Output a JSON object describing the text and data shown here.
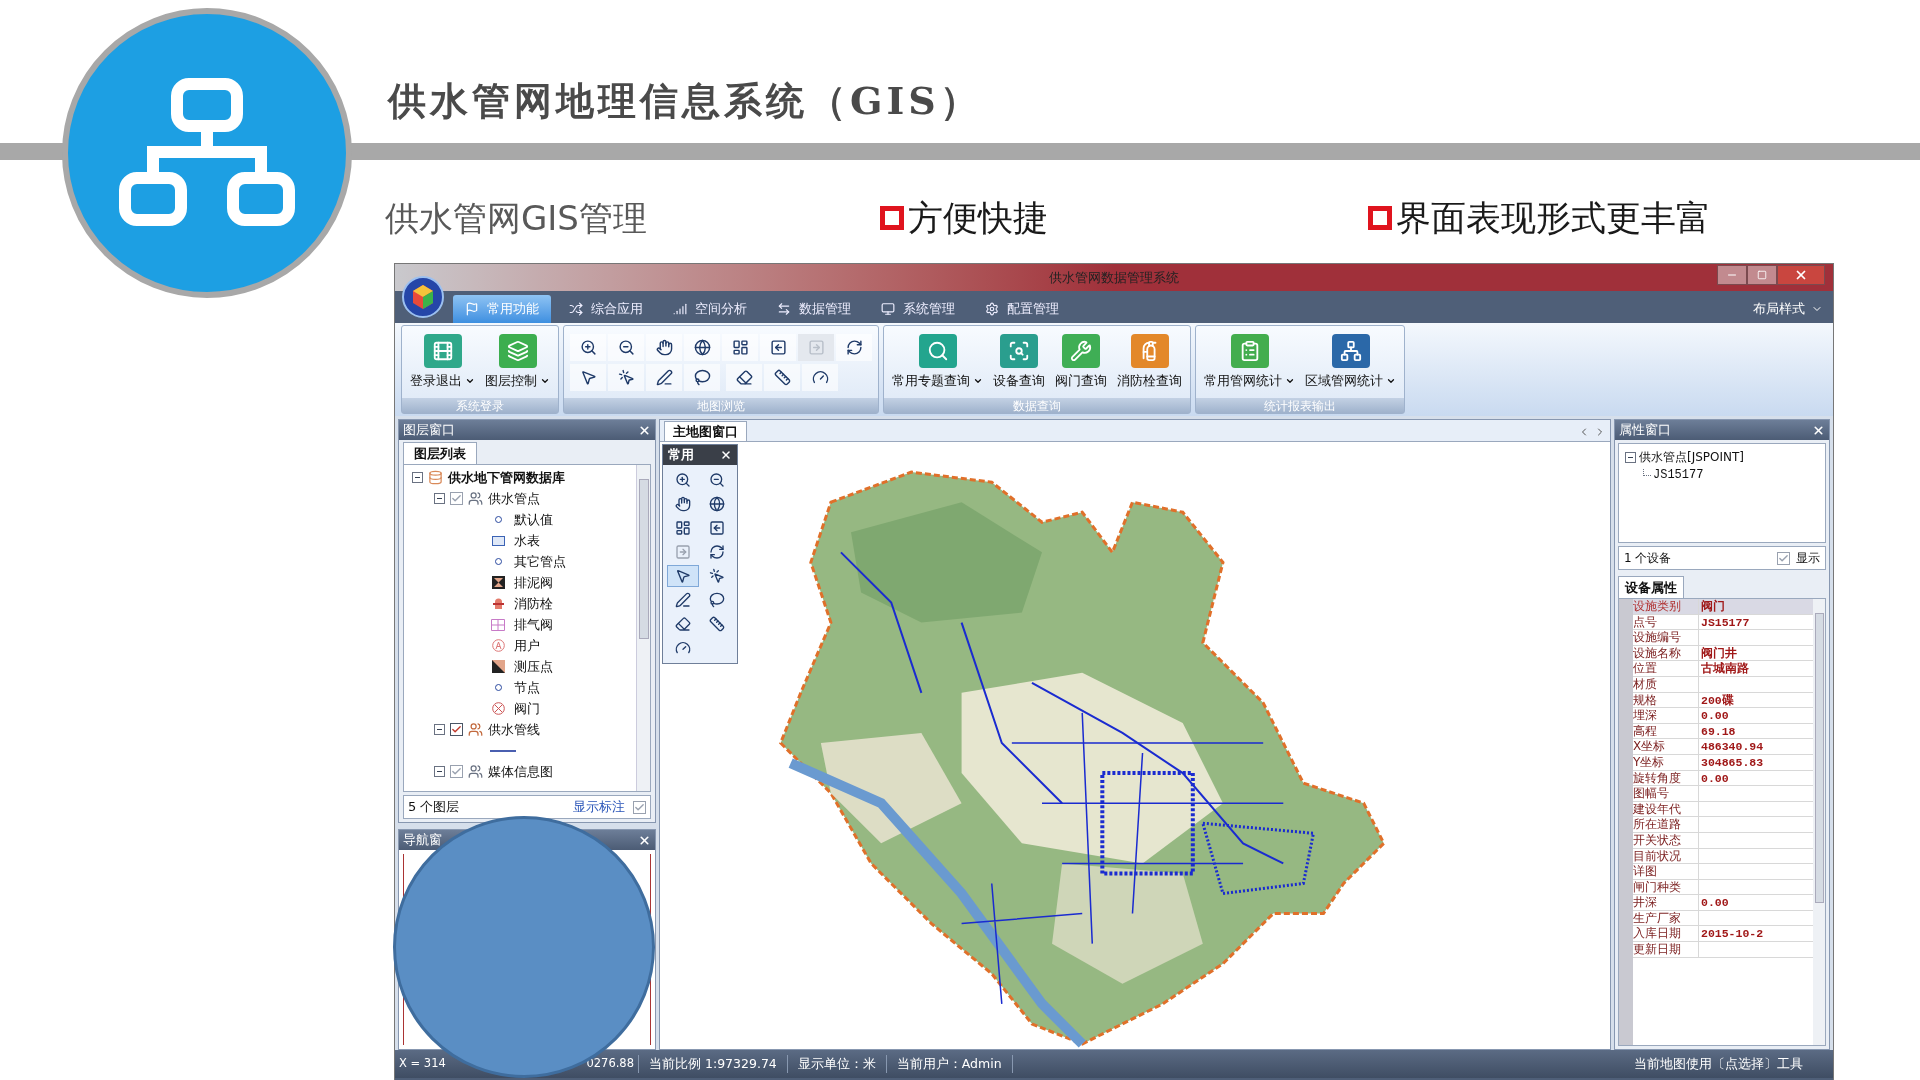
{
  "slide": {
    "title": "供水管网地理信息系统（GIS）",
    "subtitle": "供水管网GIS管理",
    "bullets": [
      "方便快捷",
      "界面表现形式更丰富"
    ]
  },
  "window": {
    "title": "供水管网数据管理系统"
  },
  "menu_tabs": [
    {
      "label": "常用功能",
      "selected": true
    },
    {
      "label": "综合应用",
      "selected": false
    },
    {
      "label": "空间分析",
      "selected": false
    },
    {
      "label": "数据管理",
      "selected": false
    },
    {
      "label": "系统管理",
      "selected": false
    },
    {
      "label": "配置管理",
      "selected": false
    }
  ],
  "layout_menu": "布局样式",
  "ribbon_groups": [
    {
      "kind": "large",
      "label": "系统登录",
      "items": [
        {
          "label": "登录退出",
          "dropdown": true
        },
        {
          "label": "图层控制",
          "dropdown": true
        }
      ]
    },
    {
      "kind": "tools",
      "label": "地图浏览",
      "rows": [
        [
          {
            "disabled": false
          },
          {
            "disabled": false
          },
          {
            "disabled": false
          },
          {
            "disabled": false
          },
          {
            "disabled": false
          },
          {
            "disabled": false
          },
          {
            "disabled": true
          },
          {
            "disabled": false
          }
        ],
        [
          {
            "disabled": false
          },
          {
            "disabled": false
          },
          {
            "disabled": false
          },
          {
            "disabled": false
          },
          {
            "disabled": false
          },
          {
            "disabled": false
          },
          {
            "disabled": false
          }
        ]
      ]
    },
    {
      "kind": "large",
      "label": "数据查询",
      "items": [
        {
          "label": "常用专题查询",
          "dropdown": true
        },
        {
          "label": "设备查询",
          "dropdown": false
        },
        {
          "label": "阀门查询",
          "dropdown": false
        },
        {
          "label": "消防栓查询",
          "dropdown": false
        }
      ]
    },
    {
      "kind": "large",
      "label": "统计报表输出",
      "items": [
        {
          "label": "常用管网统计",
          "dropdown": true
        },
        {
          "label": "区域管网统计",
          "dropdown": true
        }
      ]
    }
  ],
  "layer_window": {
    "title": "图层窗口",
    "tab": "图层列表",
    "tree": [
      {
        "kind": "database",
        "label": "供水地下管网数据库",
        "expanded": true,
        "children": [
          {
            "kind": "layer",
            "label": "供水管点",
            "expanded": true,
            "checked": true,
            "dimmed": true,
            "children": [
              {
                "kind": "dot",
                "label": "默认值"
              },
              {
                "kind": "meter",
                "label": "水表"
              },
              {
                "kind": "dot",
                "label": "其它管点"
              },
              {
                "kind": "hourglass",
                "label": "排泥阀"
              },
              {
                "kind": "hydrant",
                "label": "消防栓"
              },
              {
                "kind": "grid",
                "label": "排气阀"
              },
              {
                "kind": "user",
                "label": "用户"
              },
              {
                "kind": "triangle",
                "label": "测压点"
              },
              {
                "kind": "dot",
                "label": "节点"
              },
              {
                "kind": "cross",
                "label": "阀门"
              }
            ]
          },
          {
            "kind": "layer",
            "label": "供水管线",
            "expanded": true,
            "checked": true,
            "dimmed": false,
            "children": [
              {
                "kind": "line"
              }
            ]
          },
          {
            "kind": "layer",
            "label": "媒体信息图",
            "expanded": true,
            "checked": true,
            "dimmed": true
          }
        ]
      }
    ],
    "count": "5 个图层",
    "label_toggle": {
      "label": "显示标注",
      "checked": true
    }
  },
  "nav_window": {
    "title": "导航窗"
  },
  "map_window": {
    "tab": "主地图窗口",
    "toolbox": {
      "title": "常用",
      "tools": [
        {
          "selected": false,
          "disabled": false
        },
        {
          "selected": false,
          "disabled": false
        },
        {
          "selected": false,
          "disabled": false
        },
        {
          "selected": false,
          "disabled": false
        },
        {
          "selected": false,
          "disabled": false
        },
        {
          "selected": false,
          "disabled": false
        },
        {
          "selected": false,
          "disabled": true
        },
        {
          "selected": false,
          "disabled": false
        },
        {
          "selected": true,
          "disabled": false
        },
        {
          "selected": false,
          "disabled": false
        },
        {
          "selected": false,
          "disabled": false
        },
        {
          "selected": false,
          "disabled": false
        },
        {
          "selected": false,
          "disabled": false
        },
        {
          "selected": false,
          "disabled": false
        },
        {
          "selected": false,
          "disabled": false
        }
      ]
    }
  },
  "property_window": {
    "title": "属性窗口",
    "tree": {
      "label": "供水管点[JSPOINT]",
      "expanded": true,
      "children": [
        "JS15177"
      ]
    },
    "count": "1 个设备",
    "show": {
      "label": "显示",
      "checked": true
    },
    "tab": "设备属性",
    "rows": [
      {
        "label": "设施类别",
        "value": "阀门",
        "selected": true
      },
      {
        "label": "点号",
        "value": "JS15177",
        "selected": false
      },
      {
        "label": "设施编号",
        "selected": false
      },
      {
        "label": "设施名称",
        "value": "阀门井",
        "selected": false
      },
      {
        "label": "位置",
        "value": "古城南路",
        "selected": false
      },
      {
        "label": "材质",
        "selected": false
      },
      {
        "label": "规格",
        "value": "200碟",
        "selected": false
      },
      {
        "label": "埋深",
        "value": "0.00",
        "selected": false
      },
      {
        "label": "高程",
        "value": "69.18",
        "selected": false
      },
      {
        "label": "X坐标",
        "value": "486340.94",
        "selected": false
      },
      {
        "label": "Y坐标",
        "value": "304865.83",
        "selected": false
      },
      {
        "label": "旋转角度",
        "value": "0.00",
        "selected": false
      },
      {
        "label": "图幅号",
        "selected": false
      },
      {
        "label": "建设年代",
        "selected": false
      },
      {
        "label": "所在道路",
        "selected": false
      },
      {
        "label": "开关状态",
        "selected": false
      },
      {
        "label": "目前状况",
        "selected": false
      },
      {
        "label": "详图",
        "selected": false
      },
      {
        "label": "闸门种类",
        "selected": false
      },
      {
        "label": "井深",
        "value": "0.00",
        "selected": false
      },
      {
        "label": "生产厂家",
        "selected": false
      },
      {
        "label": "入库日期",
        "value": "2015-10-2",
        "selected": false
      },
      {
        "label": "更新日期",
        "selected": false
      }
    ]
  },
  "status_bar": {
    "coordinate_start": "X = 314",
    "coordinate_end": "0276.88",
    "items": [
      "当前比例 1:97329.74",
      "显示单位：米",
      "当前用户：Admin"
    ],
    "right": "当前地图使用〔点选择〕工具"
  }
}
